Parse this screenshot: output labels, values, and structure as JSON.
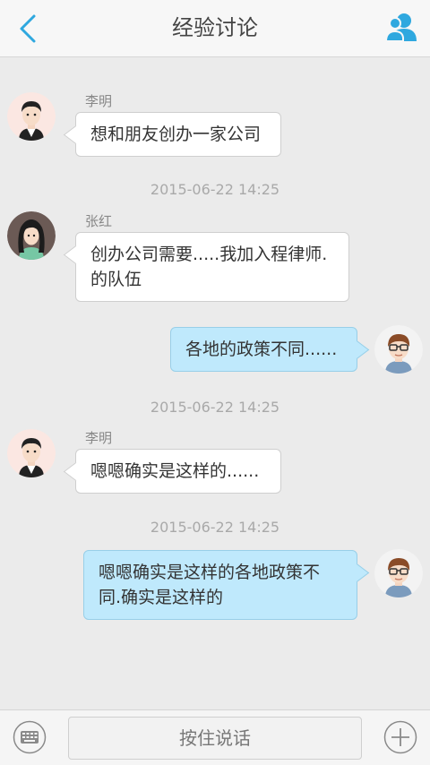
{
  "header": {
    "title": "经验讨论"
  },
  "messages": [
    {
      "name": "李明",
      "text": "想和朋友创办一家公司"
    },
    {
      "timestamp": "2015-06-22 14:25",
      "name": "张红",
      "text": "创办公司需要.....我加入程律师.的队伍"
    },
    {
      "text": "各地的政策不同......"
    },
    {
      "timestamp": "2015-06-22 14:25",
      "name": "李明",
      "text": "嗯嗯确实是这样的......"
    },
    {
      "timestamp": "2015-06-22 14:25",
      "text": "嗯嗯确实是这样的各地政策不同.确实是这样的"
    }
  ],
  "bottom": {
    "voice_label": "按住说话"
  },
  "colors": {
    "accent": "#2fa8df",
    "self_bubble": "#bfe9fc",
    "other_bubble": "#ffffff"
  },
  "icons": [
    "back-arrow-icon",
    "contacts-icon",
    "keyboard-icon",
    "plus-icon"
  ]
}
